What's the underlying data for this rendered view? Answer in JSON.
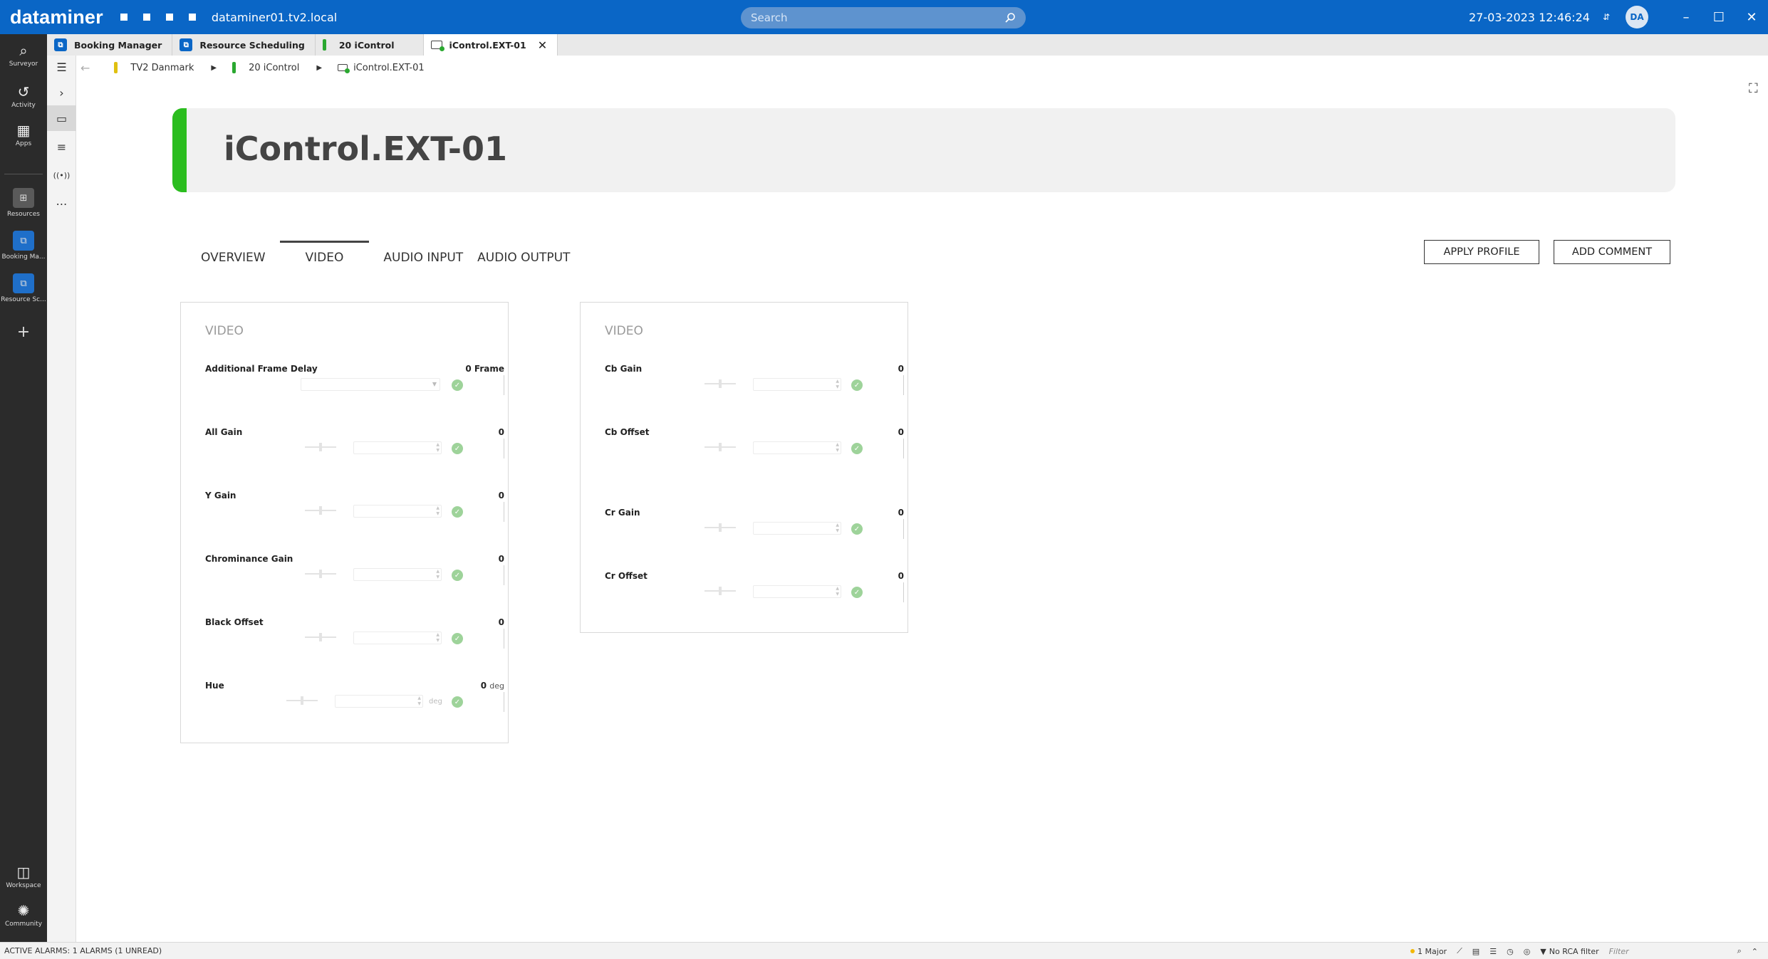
{
  "app": {
    "logo": "dataminer",
    "host": "dataminer01.tv2.local",
    "search_placeholder": "Search",
    "datetime": "27-03-2023 12:46:24",
    "user_initials": "DA"
  },
  "sidebar": {
    "items": [
      {
        "label": "Surveyor",
        "icon": "surveyor-icon"
      },
      {
        "label": "Activity",
        "icon": "history-icon"
      },
      {
        "label": "Apps",
        "icon": "apps-icon"
      },
      {
        "label": "Resources",
        "icon": "resources-icon"
      },
      {
        "label": "Booking Ma...",
        "icon": "booking-icon"
      },
      {
        "label": "Resource Sc...",
        "icon": "scheduling-icon"
      }
    ],
    "bottom": [
      {
        "label": "Workspace",
        "icon": "workspace-icon"
      },
      {
        "label": "Community",
        "icon": "community-icon"
      }
    ]
  },
  "tabs": [
    {
      "label": "Booking Manager",
      "icon": "app-icon"
    },
    {
      "label": "Resource Scheduling",
      "icon": "app-icon"
    },
    {
      "label": "20 iControl",
      "icon": "view-status-bar"
    },
    {
      "label": "iControl.EXT-01",
      "icon": "element-icon",
      "active": true
    }
  ],
  "breadcrumb": [
    {
      "label": "TV2 Danmark",
      "color": "#e0c010"
    },
    {
      "label": "20 iControl",
      "color": "#2aa830"
    },
    {
      "label": "iControl.EXT-01"
    }
  ],
  "header": {
    "title": "iControl.EXT-01",
    "accent": "#2bbd1f"
  },
  "page_tabs": [
    "OVERVIEW",
    "VIDEO",
    "AUDIO INPUT",
    "AUDIO OUTPUT"
  ],
  "active_page_tab": "VIDEO",
  "actions": {
    "apply_profile": "APPLY PROFILE",
    "add_comment": "ADD COMMENT"
  },
  "panels": [
    {
      "title": "VIDEO",
      "params": [
        {
          "label": "Additional Frame Delay",
          "value": "0",
          "unit": "Frame",
          "control": "dropdown"
        },
        {
          "label": "All Gain",
          "value": "0",
          "unit": "",
          "control": "slider"
        },
        {
          "label": "Y Gain",
          "value": "0",
          "unit": "",
          "control": "slider"
        },
        {
          "label": "Chrominance Gain",
          "value": "0",
          "unit": "",
          "control": "slider"
        },
        {
          "label": "Black Offset",
          "value": "0",
          "unit": "",
          "control": "slider"
        },
        {
          "label": "Hue",
          "value": "0",
          "unit": "deg",
          "control": "slider"
        }
      ]
    },
    {
      "title": "VIDEO",
      "params": [
        {
          "label": "Cb Gain",
          "value": "0",
          "unit": "",
          "control": "slider"
        },
        {
          "label": "Cb Offset",
          "value": "0",
          "unit": "",
          "control": "slider"
        },
        {
          "label": "Cr Gain",
          "value": "0",
          "unit": "",
          "control": "slider"
        },
        {
          "label": "Cr Offset",
          "value": "0",
          "unit": "",
          "control": "slider"
        }
      ]
    }
  ],
  "status": {
    "alarms": "ACTIVE ALARMS: 1 ALARMS (1 UNREAD)",
    "major": "1 Major",
    "rca": "No RCA filter",
    "filter_placeholder": "Filter"
  }
}
